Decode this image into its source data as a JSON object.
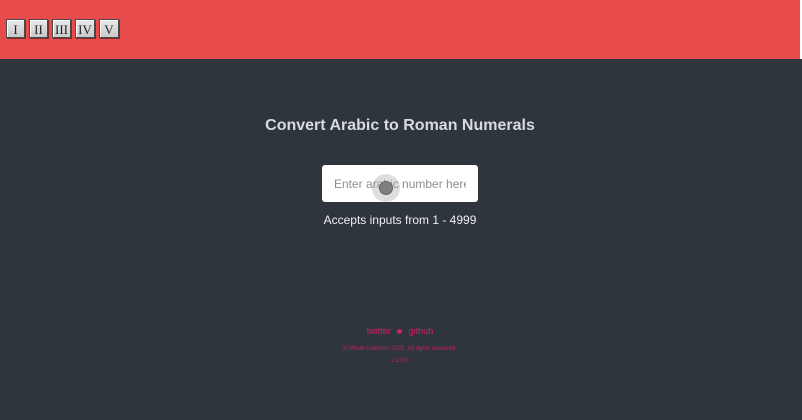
{
  "header": {
    "tiles": [
      "I",
      "II",
      "III",
      "IV",
      "V"
    ]
  },
  "main": {
    "title": "Convert Arabic to Roman Numerals",
    "input": {
      "placeholder": "Enter arabic number here",
      "value": ""
    },
    "hint": "Accepts inputs from 1 - 4999"
  },
  "footer": {
    "links": [
      "twitter",
      "github"
    ],
    "copyright": "© Mihail Gaberov 2023. All rights reserved.",
    "version": "v.1.0.0"
  },
  "colors": {
    "header": "#e84b4c",
    "background": "#2f353d",
    "footer_text": "#d0225e"
  }
}
